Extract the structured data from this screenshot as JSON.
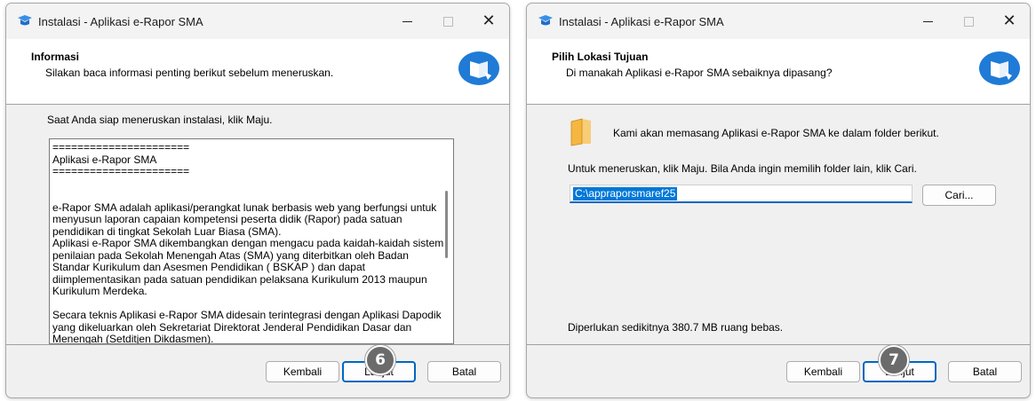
{
  "window_title": "Instalasi - Aplikasi e-Rapor SMA",
  "colors": {
    "accent": "#0067c0",
    "selection": "#0078d7",
    "logo_blue": "#1f7bd6",
    "folder": "#f5b642"
  },
  "icons": [
    "app-icon",
    "minimize-icon",
    "maximize-icon",
    "close-icon",
    "logo-icon",
    "folder-icon"
  ],
  "window_controls": {
    "minimize": "—",
    "maximize": "□",
    "close": "✕"
  },
  "info_page": {
    "header_title": "Informasi",
    "header_subtitle": "Silakan baca informasi penting berikut sebelum meneruskan.",
    "intro": "Saat Anda siap meneruskan instalasi, klik Maju.",
    "info_lines": [
      "======================",
      "Aplikasi e-Rapor SMA",
      "======================",
      "",
      "e-Rapor SMA adalah aplikasi/perangkat lunak berbasis web yang berfungsi untuk menyusun laporan capaian kompetensi peserta didik (Rapor) pada satuan pendidikan di tingkat Sekolah Luar Biasa (SMA).",
      "Aplikasi e-Rapor SMA dikembangkan dengan mengacu pada kaidah-kaidah sistem penilaian pada Sekolah Menengah Atas (SMA) yang diterbitkan oleh Badan Standar Kurikulum dan Asesmen Pendidikan ( BSKAP ) dan dapat diimplementasikan pada satuan pendidikan pelaksana Kurikulum 2013 maupun Kurikulum Merdeka.",
      "",
      "Secara teknis Aplikasi e-Rapor SMA didesain terintegrasi dengan Aplikasi Dapodik yang dikeluarkan oleh Sekretariat Direktorat Jenderal Pendidikan Dasar dan Menengah (Setditjen Dikdasmen)."
    ],
    "buttons": {
      "back": "Kembali",
      "next": "Lanjut",
      "cancel": "Batal"
    },
    "step_badge": "6"
  },
  "location_page": {
    "header_title": "Pilih Lokasi Tujuan",
    "header_subtitle": "Di manakah Aplikasi e-Rapor SMA sebaiknya dipasang?",
    "folder_text": "Kami akan memasang Aplikasi e-Rapor SMA ke dalam folder berikut.",
    "hint": "Untuk meneruskan, klik Maju. Bila Anda ingin memilih folder lain, klik Cari.",
    "path_value": "C:\\appraporsmaref25",
    "browse_label": "Cari...",
    "space_required": "Diperlukan sedikitnya 380.7 MB ruang bebas.",
    "buttons": {
      "back": "Kembali",
      "next": "Lanjut",
      "cancel": "Batal"
    },
    "step_badge": "7"
  }
}
